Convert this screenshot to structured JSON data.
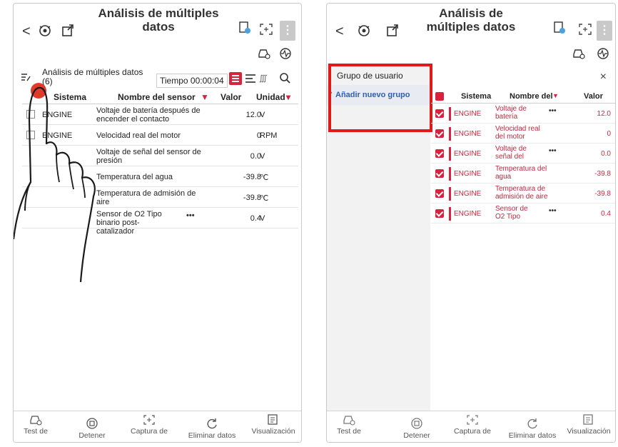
{
  "left": {
    "header": {
      "title": "Análisis de múltiples datos"
    },
    "toolbar": {
      "title": "Análisis de múltiples datos (6)",
      "time": "Tiempo 00:00:04",
      "view_label": "∭"
    },
    "table": {
      "headers": {
        "system": "Sistema",
        "sensor": "Nombre del sensor",
        "value": "Valor",
        "unit": "Unidad"
      },
      "rows": [
        {
          "system": "ENGINE",
          "sensor": "Voltaje de batería después de encender el contacto",
          "value": "12.0",
          "unit": "V"
        },
        {
          "system": "ENGINE",
          "sensor": "Velocidad real del motor",
          "value": "0",
          "unit": "RPM"
        },
        {
          "system": "",
          "sensor": "Voltaje de señal del sensor de presión",
          "value": "0.0",
          "unit": "V"
        },
        {
          "system": "",
          "sensor": "Temperatura del agua",
          "value": "-39.8",
          "unit": "℃"
        },
        {
          "system": "",
          "sensor": "Temperatura de admisión de aire",
          "value": "-39.8",
          "unit": "℃"
        },
        {
          "system": "",
          "sensor": "Sensor de O2 Tipo binario post-catalizador",
          "value": "0.4",
          "unit": "V",
          "more": "•••"
        }
      ]
    },
    "bottom": {
      "test": "Test de",
      "stop": "Detener",
      "capture": "Captura de",
      "delete": "Eliminar datos",
      "view": "Visualización"
    }
  },
  "right": {
    "header": {
      "title": "Análisis de múltiples datos"
    },
    "group_panel": {
      "title": "Grupo de usuario",
      "add_group": "Añadir nuevo grupo",
      "close": "×"
    },
    "table": {
      "headers": {
        "system": "Sistema",
        "sensor": "Nombre del",
        "value": "Valor"
      },
      "rows": [
        {
          "system": "ENGINE",
          "sensor": "Voltaje de batería",
          "value": "12.0",
          "more": "•••"
        },
        {
          "system": "ENGINE",
          "sensor": "Velocidad real del motor",
          "value": "0"
        },
        {
          "system": "ENGINE",
          "sensor": "Voltaje de señal del",
          "value": "0.0",
          "more": "•••"
        },
        {
          "system": "ENGINE",
          "sensor": "Temperatura del agua",
          "value": "-39.8"
        },
        {
          "system": "ENGINE",
          "sensor": "Temperatura de admisión de aire",
          "value": "-39.8"
        },
        {
          "system": "ENGINE",
          "sensor": "Sensor de O2 Tipo",
          "value": "0.4",
          "more": "•••"
        }
      ]
    },
    "bottom": {
      "test": "Test de",
      "stop": "Detener",
      "capture": "Captura de",
      "delete": "Eliminar datos",
      "view": "Visualización"
    }
  },
  "colors": {
    "accent": "#d6243d",
    "highlight": "#e11919",
    "link": "#2b5fb8"
  },
  "icons": [
    "back-icon",
    "engine-icon",
    "export-icon",
    "report-icon",
    "fullscreen-icon",
    "more-icon",
    "car-icon",
    "pulse-icon",
    "list-edit-icon",
    "search-icon",
    "stop-icon",
    "capture-icon",
    "refresh-icon",
    "visualize-icon",
    "hand-pointer"
  ]
}
